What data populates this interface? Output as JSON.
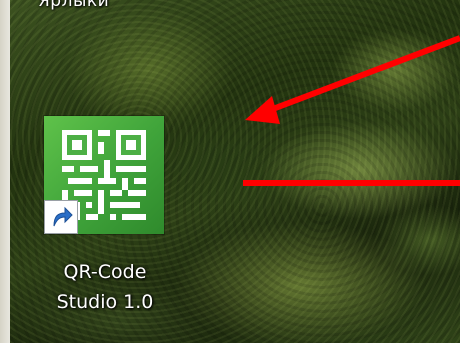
{
  "desktop": {
    "top_label": "Ярлыки",
    "icon": {
      "label_line1": "QR-Code",
      "label_line2": "Studio 1.0",
      "icon_name": "qr-code-icon",
      "badge_icon": "shortcut-arrow-icon",
      "tile_color": "#4caf45"
    }
  },
  "annotations": {
    "color": "#ff0000"
  }
}
